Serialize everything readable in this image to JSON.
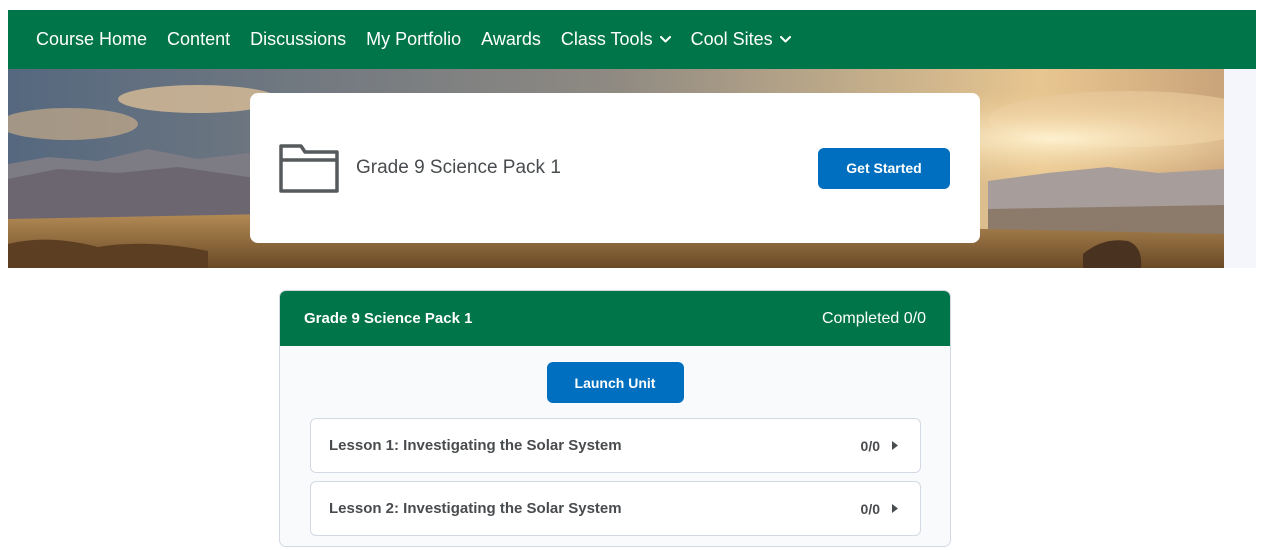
{
  "nav": {
    "items": [
      {
        "label": "Course Home",
        "has_dropdown": false
      },
      {
        "label": "Content",
        "has_dropdown": false
      },
      {
        "label": "Discussions",
        "has_dropdown": false
      },
      {
        "label": "My Portfolio",
        "has_dropdown": false
      },
      {
        "label": "Awards",
        "has_dropdown": false
      },
      {
        "label": "Class Tools",
        "has_dropdown": true
      },
      {
        "label": "Cool Sites",
        "has_dropdown": true
      }
    ]
  },
  "course_card": {
    "icon": "folder-icon",
    "title": "Grade 9 Science Pack 1",
    "button_label": "Get Started"
  },
  "unit": {
    "title": "Grade 9 Science Pack 1",
    "completion": "Completed 0/0",
    "launch_label": "Launch Unit",
    "lessons": [
      {
        "title": "Lesson 1: Investigating the Solar System",
        "progress": "0/0"
      },
      {
        "title": "Lesson 2: Investigating the Solar System",
        "progress": "0/0"
      }
    ]
  },
  "colors": {
    "brand_green": "#00754a",
    "button_blue": "#006fbf",
    "text": "#494c4e",
    "border": "#d3d9e3"
  }
}
